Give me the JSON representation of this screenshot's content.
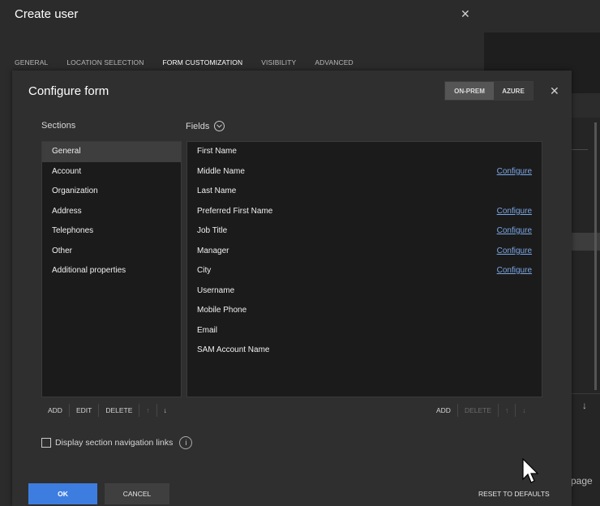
{
  "background": {
    "page_text": "page",
    "down_arrow": "↓"
  },
  "create_user": {
    "title": "Create user",
    "close_glyph": "✕",
    "tabs": [
      "GENERAL",
      "LOCATION SELECTION",
      "FORM CUSTOMIZATION",
      "VISIBILITY",
      "ADVANCED"
    ],
    "active_tab": "FORM CUSTOMIZATION"
  },
  "configure_form": {
    "title": "Configure form",
    "close_glyph": "✕",
    "toggle": {
      "on_prem": "ON-PREM",
      "azure": "AZURE",
      "selected": "ON-PREM"
    },
    "sections_label": "Sections",
    "fields_label": "Fields",
    "sections": [
      "General",
      "Account",
      "Organization",
      "Address",
      "Telephones",
      "Other",
      "Additional properties"
    ],
    "selected_section": "General",
    "fields": [
      {
        "name": "First Name",
        "link": ""
      },
      {
        "name": "Middle Name",
        "link": "Configure"
      },
      {
        "name": "Last Name",
        "link": ""
      },
      {
        "name": "Preferred First Name",
        "link": "Configure"
      },
      {
        "name": "Job Title",
        "link": "Configure"
      },
      {
        "name": "Manager",
        "link": "Configure"
      },
      {
        "name": "City",
        "link": "Configure"
      },
      {
        "name": "Username",
        "link": ""
      },
      {
        "name": "Mobile Phone",
        "link": ""
      },
      {
        "name": "Email",
        "link": ""
      },
      {
        "name": "SAM Account Name",
        "link": ""
      }
    ],
    "section_toolbar": {
      "add": "ADD",
      "edit": "EDIT",
      "delete": "DELETE",
      "up": "↑",
      "down": "↓"
    },
    "field_toolbar": {
      "add": "ADD",
      "delete": "DELETE",
      "up": "↑",
      "down": "↓"
    },
    "nav_links_label": "Display section navigation links",
    "nav_links_checked": false,
    "info_glyph": "i",
    "ok": "OK",
    "cancel": "CANCEL",
    "reset": "RESET TO DEFAULTS"
  },
  "colors": {
    "accent": "#3d7de0",
    "link": "#7ba7e6"
  }
}
